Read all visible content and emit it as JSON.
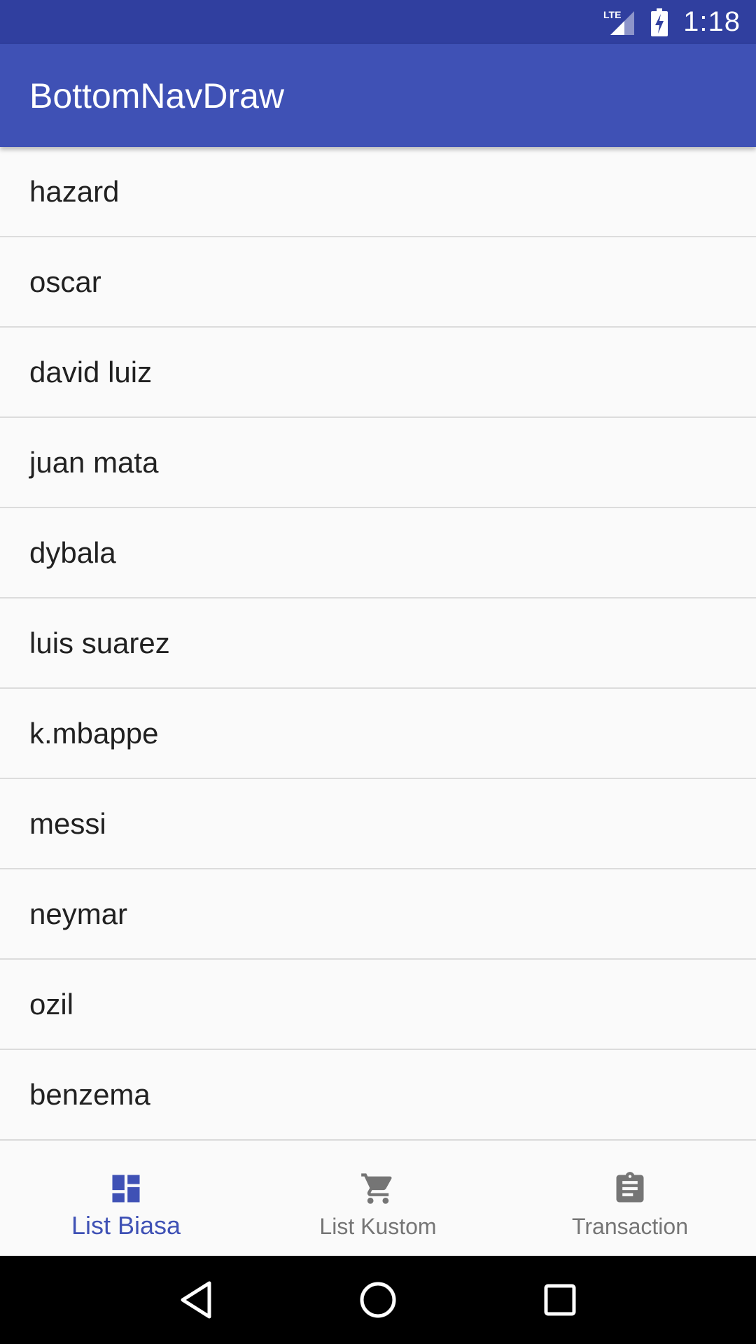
{
  "status_bar": {
    "network": "LTE",
    "time": "1:18"
  },
  "app_bar": {
    "title": "BottomNavDraw"
  },
  "list": {
    "items": [
      "hazard",
      "oscar",
      "david luiz",
      "juan mata",
      "dybala",
      "luis suarez",
      "k.mbappe",
      "messi",
      "neymar",
      "ozil",
      "benzema"
    ]
  },
  "bottom_nav": {
    "items": [
      {
        "label": "List Biasa",
        "icon": "dashboard-icon",
        "active": true
      },
      {
        "label": "List Kustom",
        "icon": "cart-icon",
        "active": false
      },
      {
        "label": "Transaction",
        "icon": "clipboard-icon",
        "active": false
      }
    ]
  },
  "colors": {
    "status_bar": "#303f9f",
    "app_bar": "#3f51b5",
    "accent": "#3f51b5",
    "inactive": "#757575"
  }
}
